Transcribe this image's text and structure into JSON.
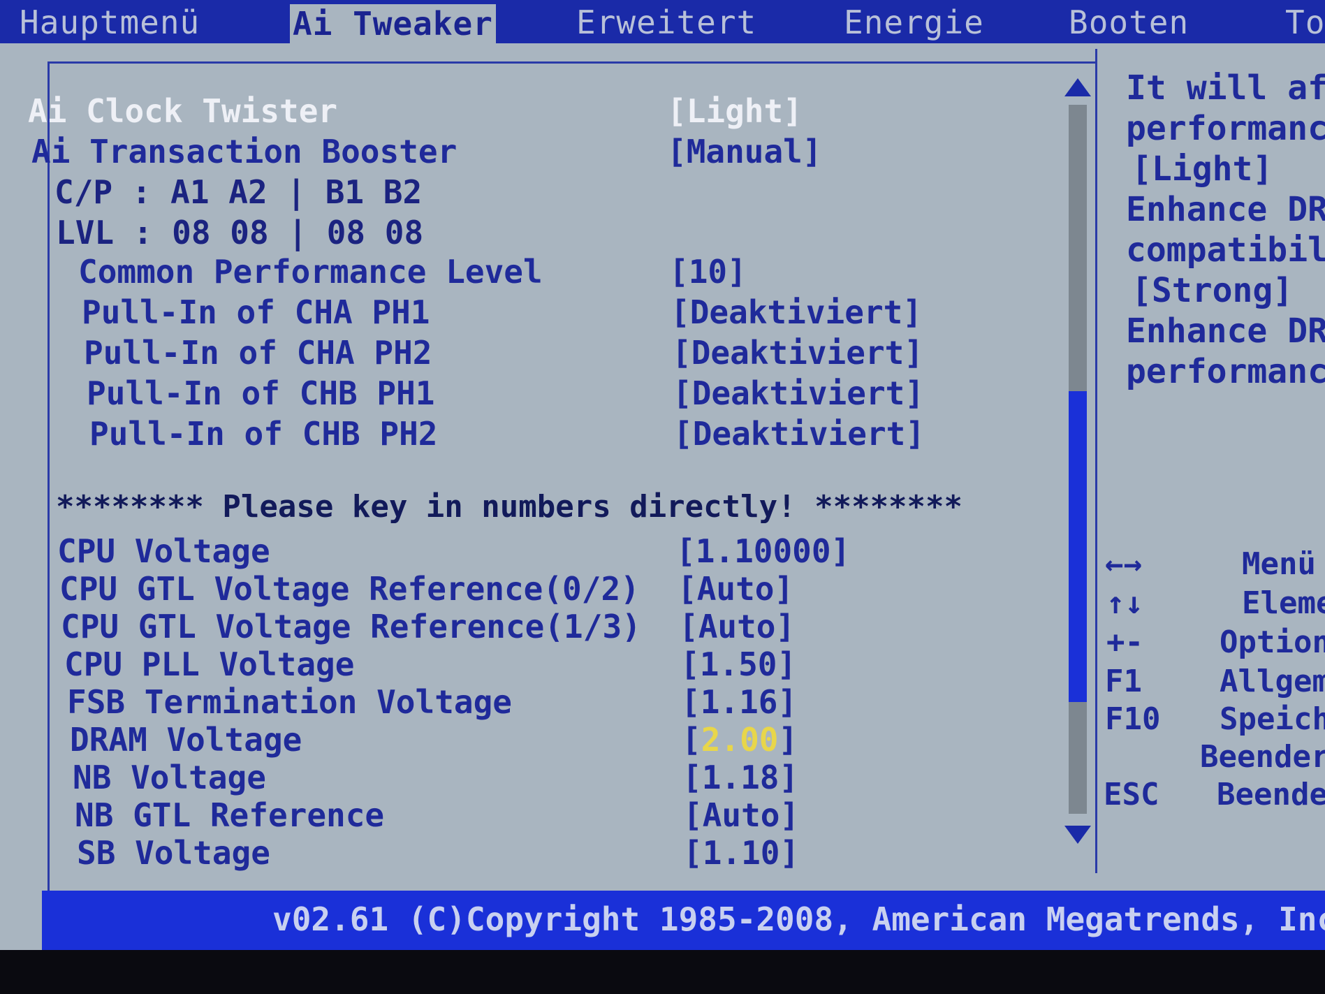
{
  "tabs": [
    "Hauptmenü",
    "Ai Tweaker",
    "Erweitert",
    "Energie",
    "Booten",
    "To"
  ],
  "active_tab": "Ai Tweaker",
  "items": {
    "clock_twister": {
      "label": "Ai Clock Twister",
      "value": "[Light]"
    },
    "transaction_booster": {
      "label": "Ai Transaction Booster",
      "value": "[Manual]"
    },
    "cp_line": "C/P : A1 A2 | B1 B2",
    "lvl_line": "LVL : 08 08 | 08 08",
    "common_perf": {
      "label": "Common Performance Level",
      "value": "[10]"
    },
    "cha_ph1": {
      "label": "Pull-In of CHA PH1",
      "value": "[Deaktiviert]"
    },
    "cha_ph2": {
      "label": "Pull-In of CHA PH2",
      "value": "[Deaktiviert]"
    },
    "chb_ph1": {
      "label": "Pull-In of CHB PH1",
      "value": "[Deaktiviert]"
    },
    "chb_ph2": {
      "label": "Pull-In of CHB PH2",
      "value": "[Deaktiviert]"
    },
    "key_in_note": "******** Please key in numbers directly! ********",
    "cpu_voltage": {
      "label": "CPU Voltage",
      "value": "[1.10000]"
    },
    "gtl_02": {
      "label": "CPU GTL Voltage Reference(0/2)",
      "value": "[Auto]"
    },
    "gtl_13": {
      "label": "CPU GTL Voltage Reference(1/3)",
      "value": "[Auto]"
    },
    "pll": {
      "label": "CPU PLL Voltage",
      "value": "[1.50]"
    },
    "fsb": {
      "label": "FSB Termination Voltage",
      "value": "[1.16]"
    },
    "dram": {
      "label": "DRAM Voltage",
      "open": "[",
      "value": "2.00",
      "close": "]"
    },
    "nb_voltage": {
      "label": "NB Voltage",
      "value": "[1.18]"
    },
    "nb_gtl": {
      "label": "NB GTL Reference",
      "value": "[Auto]"
    },
    "sb_voltage": {
      "label": "SB Voltage",
      "value": "[1.10]"
    }
  },
  "help": [
    "It will af",
    "performanc",
    "[Light]",
    "Enhance DR",
    "compatibil",
    "[Strong]",
    "Enhance DR",
    "performanc"
  ],
  "keys": [
    {
      "key": "←→",
      "desc": "Menü"
    },
    {
      "key": "↑↓",
      "desc": "Eleme"
    },
    {
      "key": "+-",
      "desc": "Option"
    },
    {
      "key": "F1",
      "desc": "Allgem"
    },
    {
      "key": "F10",
      "desc": "Speich"
    },
    {
      "key": "",
      "desc": "Beender"
    },
    {
      "key": "ESC",
      "desc": "Beende"
    }
  ],
  "footer": "v02.61 (C)Copyright 1985-2008, American Megatrends, Inc"
}
